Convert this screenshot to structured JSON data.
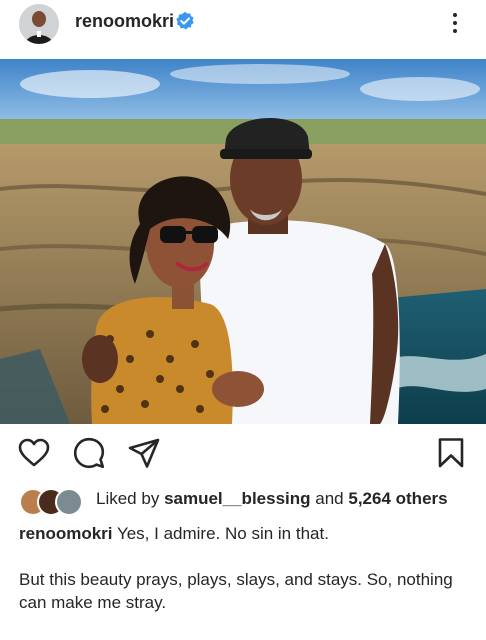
{
  "header": {
    "username": "renoomokri",
    "verified": true,
    "icons": [
      "avatar",
      "verified-badge-icon",
      "more-options-icon"
    ]
  },
  "post": {
    "image_description_icons": [
      "photo"
    ]
  },
  "actions": {
    "icons": [
      "heart-icon",
      "comment-icon",
      "share-icon",
      "bookmark-icon"
    ]
  },
  "likes": {
    "prefix": "Liked by",
    "liked_by_user": "samuel__blessing",
    "connector": "and",
    "others_count": "5,264 others"
  },
  "caption": {
    "username": "renoomokri",
    "line1": "Yes, I admire. No sin in that.",
    "line2": "But this beauty prays, plays, slays, and stays. So, nothing can make me stray."
  },
  "colors": {
    "verified_blue": "#3897f0",
    "text": "#262626"
  }
}
